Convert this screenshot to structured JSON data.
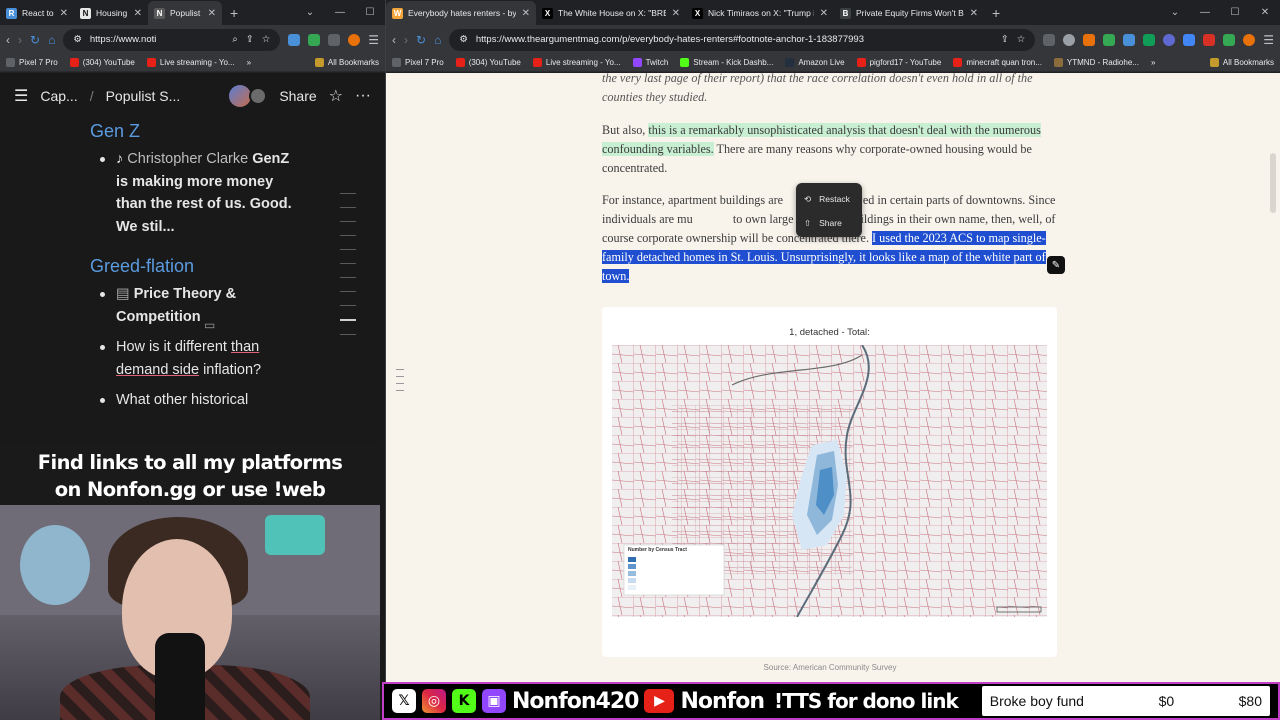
{
  "left_browser": {
    "tabs": [
      {
        "title": "React to",
        "color": "#4a90d9",
        "glyph": "R",
        "active": false
      },
      {
        "title": "Housing",
        "color": "#e8e8e8",
        "glyph": "N",
        "active": false
      },
      {
        "title": "Populist",
        "color": "#5a5a5a",
        "glyph": "N",
        "active": true
      }
    ],
    "url": "https://www.noti",
    "bookmarks": [
      {
        "label": "Pixel 7 Pro",
        "color": "#5f6368"
      },
      {
        "label": "(304) YouTube",
        "color": "#e62117"
      },
      {
        "label": "Live streaming - Yo...",
        "color": "#e62117"
      }
    ],
    "bookmarks_more": "»",
    "all_bookmarks": "All Bookmarks"
  },
  "notion": {
    "breadcrumb_1": "Cap...",
    "breadcrumb_sep": "/",
    "breadcrumb_2": "Populist S...",
    "share": "Share",
    "sections": [
      {
        "heading": "Gen Z",
        "items": [
          {
            "prefix": "Christopher Clarke",
            "text": "GenZ is making more money than the rest of us. Good. We stil..."
          }
        ]
      },
      {
        "heading": "Greed-flation",
        "items": [
          {
            "text": "Price Theory & Competition"
          },
          {
            "text_a": "How is it different",
            "text_b": "than",
            "text_c": "demand side",
            "text_d": "inflation?"
          },
          {
            "text": "What other historical"
          }
        ]
      }
    ]
  },
  "overlay": {
    "promo_line1": "Find links to all my platforms",
    "promo_line2": "on Nonfon.gg or use !web"
  },
  "right_browser": {
    "tabs": [
      {
        "title": "Everybody hates renters - by Je",
        "color": "#f2a33a",
        "glyph": "W",
        "active": true
      },
      {
        "title": "The White House on X: \"BREAK",
        "color": "#000000",
        "glyph": "X",
        "active": false
      },
      {
        "title": "Nick Timiraos on X: \"Trump is c",
        "color": "#000000",
        "glyph": "X",
        "active": false
      },
      {
        "title": "Private Equity Firms Won't Be I",
        "color": "#3c4043",
        "glyph": "B",
        "active": false
      }
    ],
    "url": "https://www.theargumentmag.com/p/everybody-hates-renters#footnote-anchor-1-183877993",
    "bookmarks": [
      {
        "label": "Pixel 7 Pro",
        "color": "#5f6368"
      },
      {
        "label": "(304) YouTube",
        "color": "#e62117"
      },
      {
        "label": "Live streaming - Yo...",
        "color": "#e62117"
      },
      {
        "label": "Twitch",
        "color": "#9146ff"
      },
      {
        "label": "Stream - Kick Dashb...",
        "color": "#53fc18"
      },
      {
        "label": "Amazon Live",
        "color": "#232f3e"
      },
      {
        "label": "pigford17 - YouTube",
        "color": "#e62117"
      },
      {
        "label": "minecraft quan tron...",
        "color": "#e62117"
      },
      {
        "label": "YTMND - Radiohe...",
        "color": "#8a6d3b"
      }
    ],
    "bookmarks_more": "»",
    "all_bookmarks": "All Bookmarks"
  },
  "article": {
    "p0": "the very last page of their report) that the race correlation doesn't even hold in all of the counties they studied.",
    "p1_a": "But also, ",
    "p1_hl": "this is a remarkably unsophisticated analysis that doesn't deal with the numerous confounding variables.",
    "p1_b": " There are many reasons why corporate-owned housing would be concentrated.",
    "p2_a": "For instance, apartment buildings are",
    "p2_b": "llowed in certain parts of downtowns. Since individuals are mu",
    "p2_c": " to own large apartment buildings in their own name, then, well, of course corporate ownership will be concentrated there.",
    "p2_sel": "I used the 2023 ACS to map single-family detached homes in St. Louis. Unsurprisingly, it looks like a map of the white part of town.",
    "context_menu": {
      "restack": "Restack",
      "share": "Share"
    },
    "figure_title": "1, detached - Total:",
    "legend_title": "Number by Census Tract",
    "caption": "Source: American Community Survey"
  },
  "stream_bar": {
    "handle1": "Nonfon420",
    "handle2": "Nonfon",
    "tts": "!TTS for dono link",
    "goal_name": "Broke boy fund",
    "goal_current": "$0",
    "goal_target": "$80"
  },
  "colors": {
    "accent_blue": "#5a9be0",
    "selection": "#1f4fd0",
    "highlight": "#c9efd3",
    "stream_border": "#c040c8"
  }
}
